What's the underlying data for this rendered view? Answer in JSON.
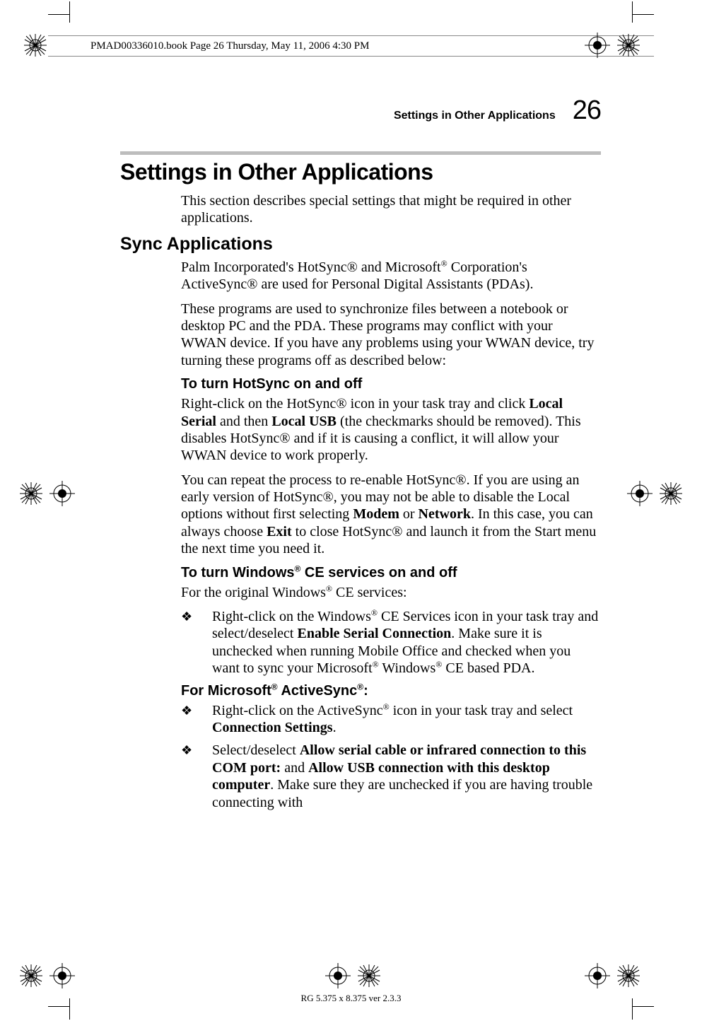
{
  "header": {
    "filename_line": "PMAD00336010.book  Page 26  Thursday, May 11, 2006  4:30 PM"
  },
  "running_head": {
    "label": "Settings in Other Applications",
    "page": "26"
  },
  "section": {
    "title": "Settings in Other Applications",
    "intro": "This section describes special settings that might be required in other applications."
  },
  "sync": {
    "title": "Sync Applications",
    "p1_a": "Palm Incorporated's HotSync® and Microsoft",
    "p1_b": " Corporation's ActiveSync® are used for Personal Digital Assistants (PDAs).",
    "p2": "These programs are used to synchronize files between a notebook or desktop PC and the PDA. These programs may conflict with your WWAN device. If you have any problems using your WWAN device, try turning these programs off as described below:",
    "hotsync_title": "To turn HotSync on and off",
    "hotsync_p1_a": "Right-click on the HotSync® icon in your task tray and click ",
    "hotsync_p1_b": "Local Serial",
    "hotsync_p1_c": " and then ",
    "hotsync_p1_d": "Local USB",
    "hotsync_p1_e": " (the checkmarks should be removed). This disables HotSync® and if it is causing a conflict, it will allow your WWAN device to work properly.",
    "hotsync_p2_a": "You can repeat the process to re-enable HotSync®. If you are using an early version of HotSync®, you may not be able to disable the Local options without first selecting ",
    "hotsync_p2_b": "Modem",
    "hotsync_p2_c": " or ",
    "hotsync_p2_d": "Network",
    "hotsync_p2_e": ". In this case, you can always choose ",
    "hotsync_p2_f": "Exit",
    "hotsync_p2_g": " to close HotSync® and launch it from the Start menu the next time you need it.",
    "ce_title_a": "To turn Windows",
    "ce_title_b": " CE services on and off",
    "ce_p1_a": "For the original Windows",
    "ce_p1_b": " CE services:",
    "ce_li1_a": "Right-click on the Windows",
    "ce_li1_b": " CE Services icon in your task tray and select/deselect ",
    "ce_li1_c": "Enable Serial Connection",
    "ce_li1_d": ". Make sure it is unchecked when running Mobile Office and checked when you want to sync your Microsoft",
    "ce_li1_e": " Windows",
    "ce_li1_f": " CE based PDA.",
    "activesync_title_a": "For Microsoft",
    "activesync_title_b": " ActiveSync",
    "activesync_title_c": ":",
    "as_li1_a": "Right-click on the ActiveSync",
    "as_li1_b": " icon in your task tray and select ",
    "as_li1_c": "Connection Settings",
    "as_li1_d": ".",
    "as_li2_a": "Select/deselect ",
    "as_li2_b": "Allow serial cable or infrared connection to this COM port:",
    "as_li2_c": " and ",
    "as_li2_d": "Allow USB connection with this desktop computer",
    "as_li2_e": ". Make sure they are unchecked if you are having trouble connecting with"
  },
  "footer": "RG 5.375 x 8.375 ver 2.3.3",
  "glyphs": {
    "reg_mark": "®",
    "diamond": "❖"
  }
}
